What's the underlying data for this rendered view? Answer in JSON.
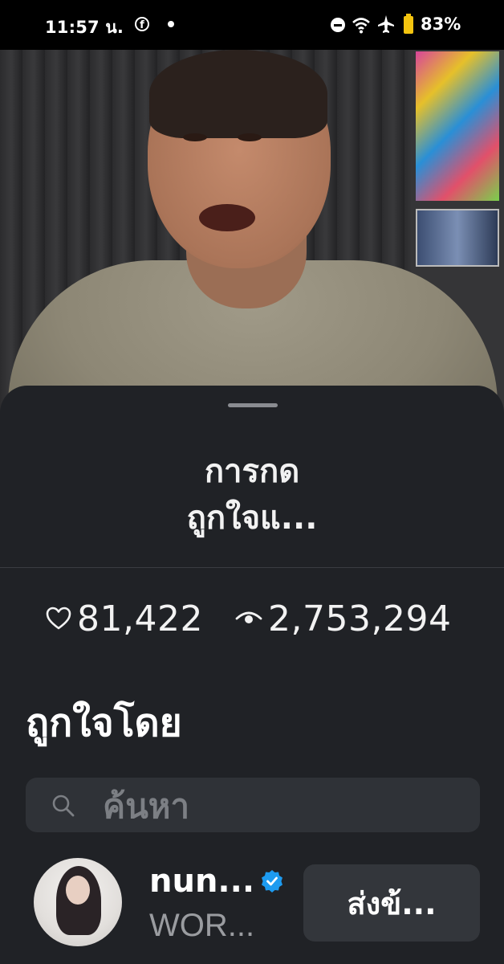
{
  "status_bar": {
    "time": "11:57 น.",
    "notification_icon": "facebook-icon",
    "battery": "83%",
    "icons": [
      "do-not-disturb-icon",
      "wifi-icon",
      "airplane-icon",
      "battery-icon"
    ],
    "battery_color": "#f4c40f"
  },
  "sheet": {
    "title_line1": "การกด",
    "title_line2": "ถูกใจแ...",
    "likes": "81,422",
    "views": "2,753,294",
    "section_heading": "ถูกใจโดย",
    "search_placeholder": "ค้นหา",
    "background_color": "#202226",
    "users": [
      {
        "name": "nun...",
        "subtitle": "WOR...",
        "verified": true,
        "button_label": "ส่งข้..."
      }
    ]
  },
  "colors": {
    "verified": "#1d9bf0",
    "search_bg": "#2f3237",
    "button_bg": "#33363b"
  }
}
